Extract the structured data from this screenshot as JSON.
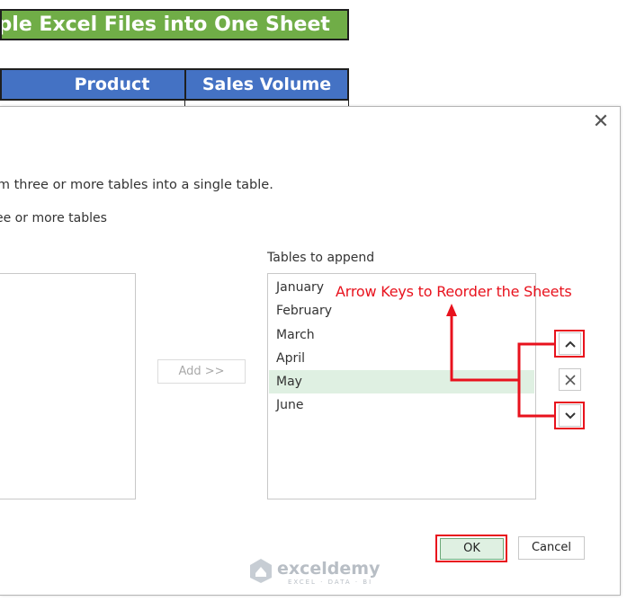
{
  "spreadsheet": {
    "title": "iple Excel Files into One Sheet",
    "headers": [
      "Product",
      "Sales Volume"
    ],
    "colors": {
      "title_bg": "#70ad47",
      "header_bg": "#4472c4"
    }
  },
  "dialog": {
    "description": "om three or more tables into a single table.",
    "option_label": "ee or more tables",
    "add_button": "Add >>",
    "tables_to_append_label": "Tables to append",
    "tables_to_append": [
      "January",
      "February",
      "March",
      "April",
      "May",
      "June"
    ],
    "selected_table": "May",
    "ok_label": "OK",
    "cancel_label": "Cancel",
    "icons": {
      "close": "close-icon",
      "up": "chevron-up-icon",
      "remove": "remove-x-icon",
      "down": "chevron-down-icon"
    }
  },
  "annotation": {
    "text": "Arrow Keys to Reorder the Sheets",
    "color": "#e8121d"
  },
  "watermark": {
    "name": "exceldemy",
    "tagline": "EXCEL · DATA · BI"
  }
}
